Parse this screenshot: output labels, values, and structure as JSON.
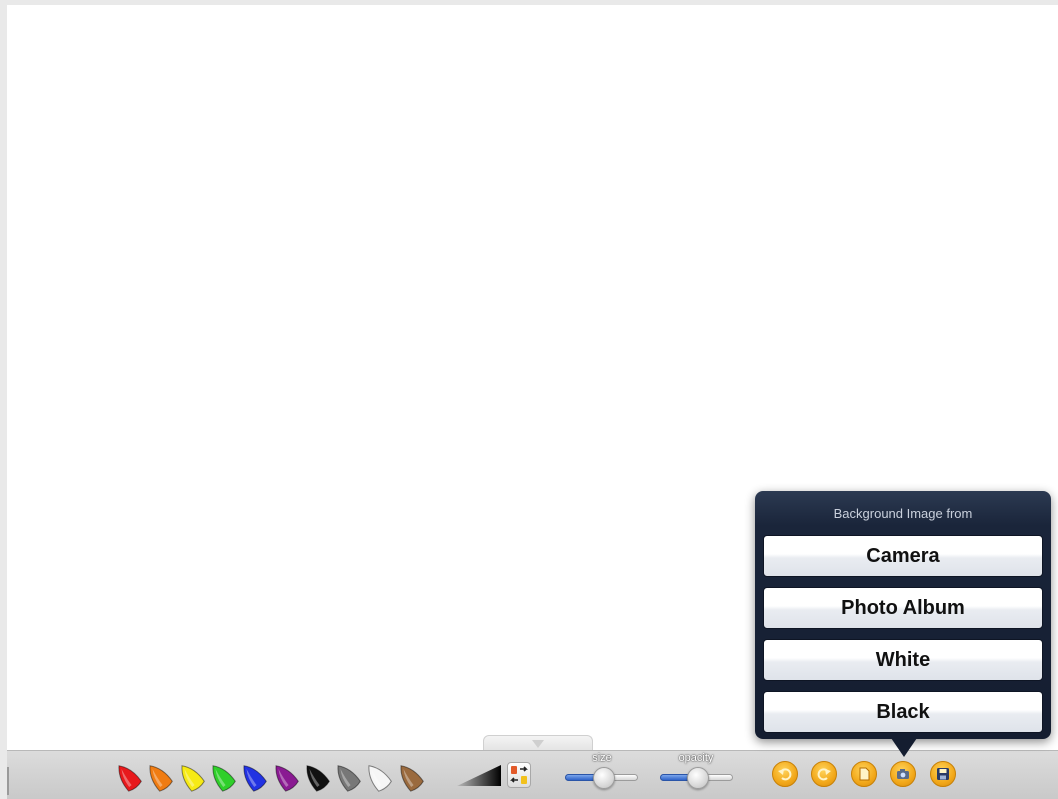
{
  "toolbar": {
    "crayons": [
      {
        "name": "red",
        "color": "#e8191c"
      },
      {
        "name": "orange",
        "color": "#f07c12"
      },
      {
        "name": "yellow",
        "color": "#f6ea16"
      },
      {
        "name": "green",
        "color": "#2fcf2a"
      },
      {
        "name": "blue",
        "color": "#2232e2"
      },
      {
        "name": "purple",
        "color": "#8a1a92"
      },
      {
        "name": "black",
        "color": "#111111"
      },
      {
        "name": "gray",
        "color": "#777777"
      },
      {
        "name": "white",
        "color": "#f6f6f6"
      },
      {
        "name": "brown",
        "color": "#9a6a3e"
      }
    ],
    "size_label": "size",
    "size_value": 0.55,
    "opacity_label": "opacity",
    "opacity_value": 0.52,
    "actions": [
      "undo-icon",
      "redo-icon",
      "new-page-icon",
      "camera-icon",
      "save-icon"
    ],
    "accent_color": "#f2a81a"
  },
  "popover": {
    "title": "Background Image from",
    "options": [
      "Camera",
      "Photo Album",
      "White",
      "Black"
    ]
  }
}
